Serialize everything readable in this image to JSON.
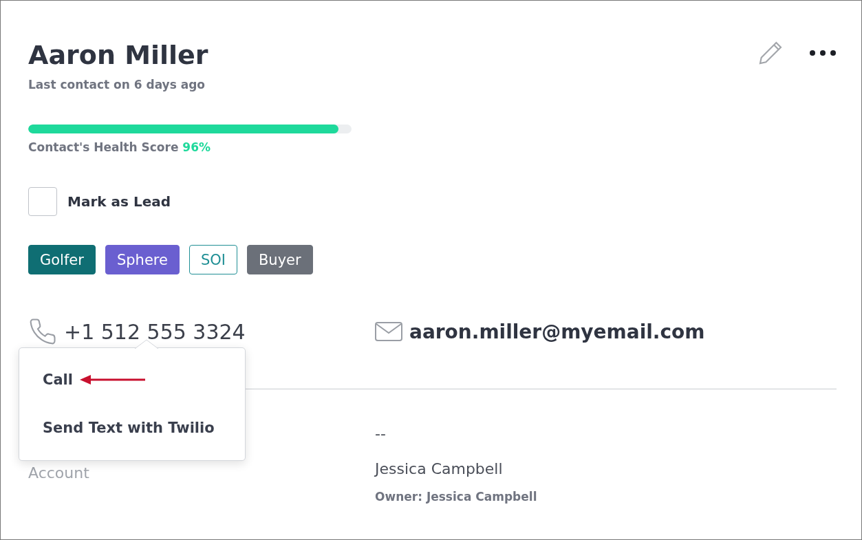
{
  "contact": {
    "name": "Aaron Miller",
    "last_contact": "Last contact on 6 days ago"
  },
  "health": {
    "label": "Contact's Health Score",
    "value": "96%",
    "level": 0.96
  },
  "mark_as_lead": {
    "label": "Mark as Lead",
    "checked": false
  },
  "tags": [
    {
      "label": "Golfer",
      "kind": "filled",
      "color": "#0f6e73"
    },
    {
      "label": "Sphere",
      "kind": "filled",
      "color": "#6a5fd0"
    },
    {
      "label": "SOI",
      "kind": "outline",
      "color": "#1f8f95"
    },
    {
      "label": "Buyer",
      "kind": "filled",
      "color": "#6b7079"
    }
  ],
  "phone": "+1 512 555 3324",
  "email": "aaron.miller@myemail.com",
  "details": [
    {
      "value": "--"
    },
    {
      "label": "Account",
      "value": "Jessica Campbell",
      "owner": "Owner: Jessica Campbell"
    }
  ],
  "phone_menu": {
    "items": [
      "Call",
      "Send Text with Twilio"
    ]
  }
}
